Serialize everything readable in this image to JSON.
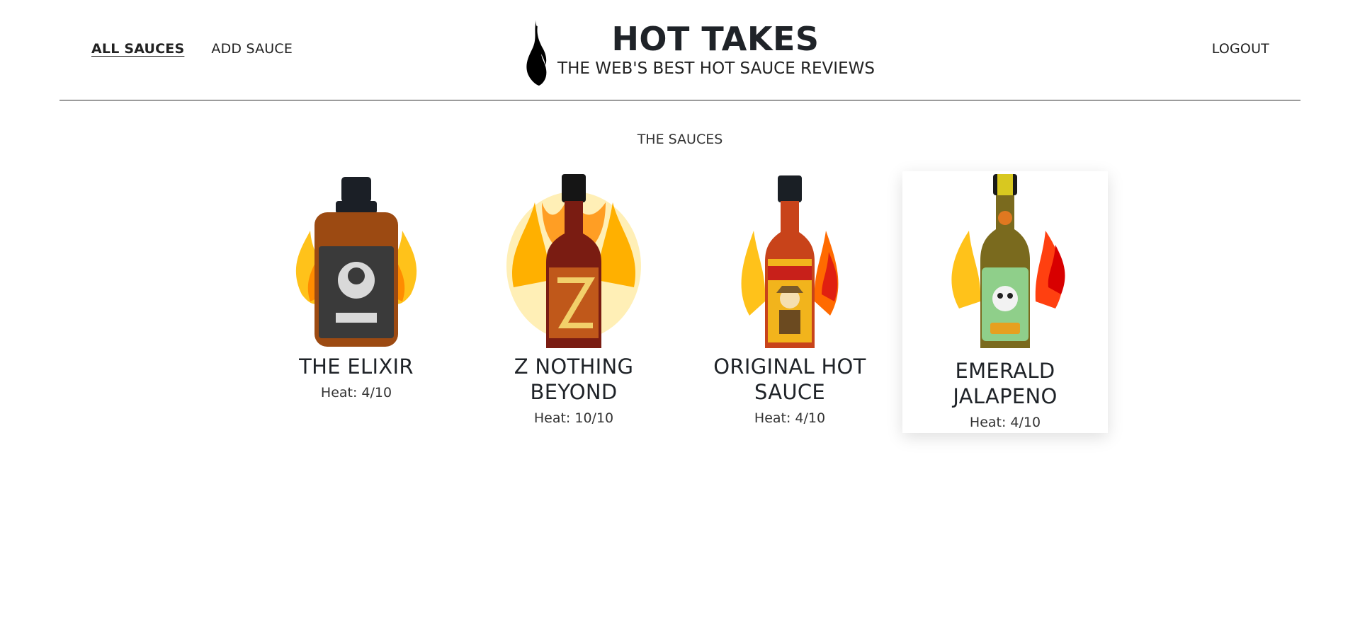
{
  "nav": {
    "all_sauces": "ALL SAUCES",
    "add_sauce": "ADD SAUCE",
    "logout": "LOGOUT"
  },
  "brand": {
    "title": "HOT TAKES",
    "subtitle": "THE WEB'S BEST HOT SAUCE REVIEWS",
    "logo_icon": "flame-icon"
  },
  "section_title": "THE SAUCES",
  "sauces": [
    {
      "name": "THE ELIXIR",
      "heat": "Heat: 4/10",
      "label_color": "#3a3a3a",
      "liquid_color": "#9c4a12",
      "cap_color": "#1b1f26"
    },
    {
      "name": "Z NOTHING BEYOND",
      "heat": "Heat: 10/10",
      "label_color": "#c0581a",
      "liquid_color": "#7a1c12",
      "cap_color": "#151515"
    },
    {
      "name": "ORIGINAL HOT SAUCE",
      "heat": "Heat: 4/10",
      "label_color": "#f2b41c",
      "liquid_color": "#c8431a",
      "cap_color": "#1a1f25"
    },
    {
      "name": "EMERALD JALAPENO",
      "heat": "Heat: 4/10",
      "label_color": "#8fcf8a",
      "liquid_color": "#7a6a1e",
      "cap_color": "#1a1a1a"
    }
  ],
  "colors": {
    "flame_outer": "#ffc21a",
    "flame_inner": "#ff7a00",
    "text_dark": "#1f2328"
  }
}
